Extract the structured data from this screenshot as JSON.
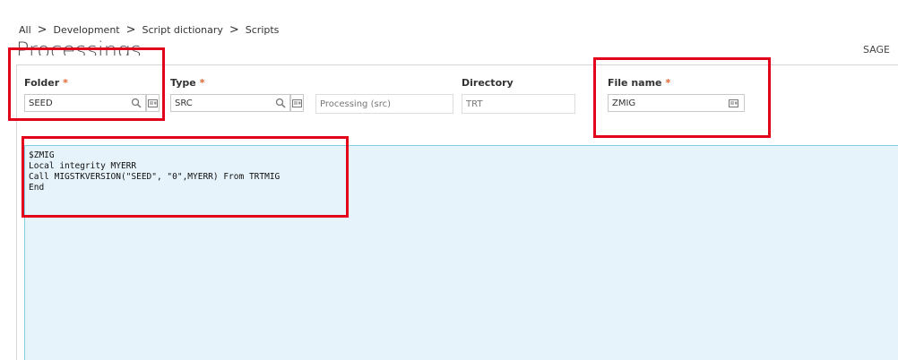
{
  "breadcrumb": {
    "items": [
      "All",
      "Development",
      "Script dictionary",
      "Scripts"
    ],
    "separator": ">"
  },
  "page": {
    "title": "Processings",
    "user": "SAGE"
  },
  "fields": {
    "folder": {
      "label": "Folder",
      "required_mark": "*",
      "value": "SEED"
    },
    "type": {
      "label": "Type",
      "required_mark": "*",
      "value": "SRC",
      "description": "Processing (src)"
    },
    "directory": {
      "label": "Directory",
      "value": "TRT"
    },
    "file_name": {
      "label": "File name",
      "required_mark": "*",
      "value": "ZMIG"
    }
  },
  "editor": {
    "lines": [
      "$ZMIG",
      "Local integrity MYERR",
      "Call MIGSTKVERSION(\"SEED\", \"0\",MYERR) From TRTMIG",
      "End"
    ]
  },
  "colors": {
    "required": "#e8632c",
    "highlight": "#e2001a",
    "editor_bg": "#e6f3fa",
    "editor_border": "#7fd0e0"
  },
  "icons": {
    "search": "search-icon",
    "browse": "card-icon"
  }
}
